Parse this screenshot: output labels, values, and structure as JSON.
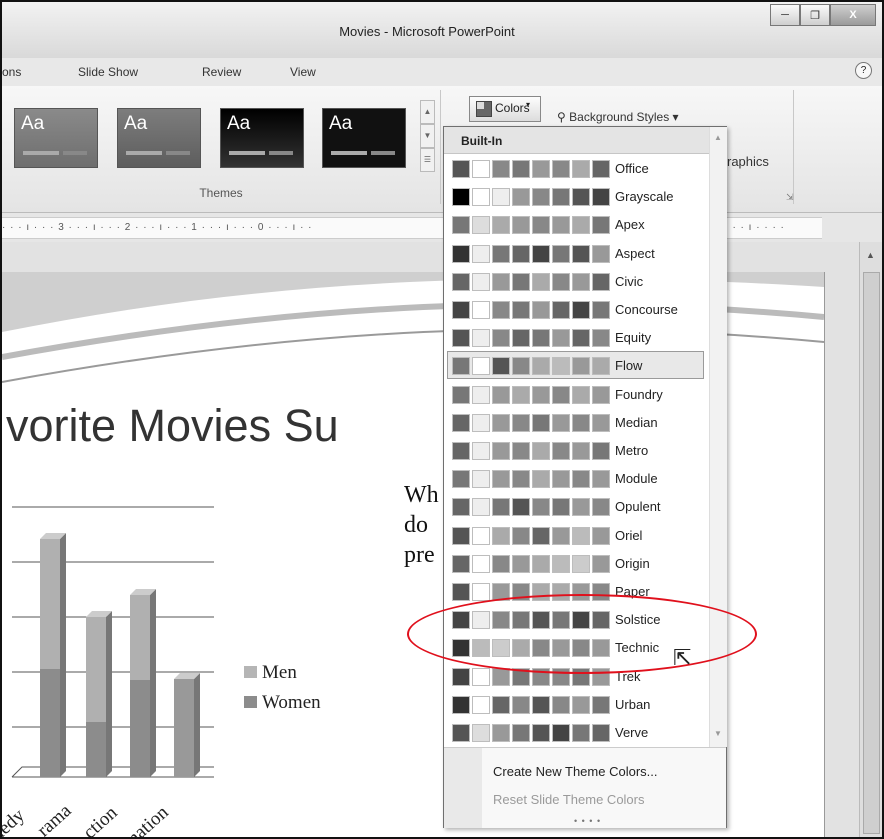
{
  "window": {
    "title": "Movies - Microsoft PowerPoint",
    "minimize": "─",
    "restore": "❐",
    "close": "X"
  },
  "ribbon_tabs": [
    "ons",
    "Slide Show",
    "Review",
    "View"
  ],
  "help": "?",
  "themes_group": {
    "label": "Themes",
    "thumbnails": [
      {
        "text": "Aa"
      },
      {
        "text": "Aa"
      },
      {
        "text": "Aa"
      },
      {
        "text": "Aa"
      }
    ]
  },
  "colors_button": {
    "label": "Colors"
  },
  "background_styles": {
    "label": "Background Styles"
  },
  "graphics_label": "raphics",
  "ruler": {
    "left": "· · · ı · · · 3 · · · ı · · · 2 · · · ı · · · 1 · · · ı · · · 0 · · · ı · ·",
    "right": "3 · · · ı · · · ·"
  },
  "slide": {
    "title": "vorite Movies Su",
    "body_lines": [
      "Wh",
      "do",
      "pre"
    ],
    "legend": [
      {
        "label": "Men",
        "color": "#b5b5b5"
      },
      {
        "label": "Women",
        "color": "#8c8c8c"
      }
    ],
    "categories": [
      "nedy",
      "rama",
      "ction",
      "nation"
    ]
  },
  "colors_dropdown": {
    "header": "Built-In",
    "selected": "Flow",
    "highlighted": "Technic",
    "themes": [
      {
        "name": "Office",
        "swatches": [
          "#555",
          "#fff",
          "#888",
          "#777",
          "#999",
          "#888",
          "#aaa",
          "#666"
        ]
      },
      {
        "name": "Grayscale",
        "swatches": [
          "#000",
          "#fff",
          "#eee",
          "#999",
          "#888",
          "#777",
          "#555",
          "#444"
        ]
      },
      {
        "name": "Apex",
        "swatches": [
          "#777",
          "#ddd",
          "#aaa",
          "#999",
          "#888",
          "#999",
          "#aaa",
          "#777"
        ]
      },
      {
        "name": "Aspect",
        "swatches": [
          "#333",
          "#eee",
          "#777",
          "#666",
          "#444",
          "#777",
          "#555",
          "#999"
        ]
      },
      {
        "name": "Civic",
        "swatches": [
          "#666",
          "#eee",
          "#999",
          "#777",
          "#aaa",
          "#888",
          "#999",
          "#666"
        ]
      },
      {
        "name": "Concourse",
        "swatches": [
          "#444",
          "#fff",
          "#888",
          "#777",
          "#999",
          "#666",
          "#444",
          "#777"
        ]
      },
      {
        "name": "Equity",
        "swatches": [
          "#555",
          "#eee",
          "#888",
          "#666",
          "#777",
          "#999",
          "#666",
          "#888"
        ]
      },
      {
        "name": "Flow",
        "swatches": [
          "#777",
          "#fff",
          "#555",
          "#888",
          "#aaa",
          "#bbb",
          "#999",
          "#aaa"
        ]
      },
      {
        "name": "Foundry",
        "swatches": [
          "#777",
          "#eee",
          "#999",
          "#aaa",
          "#999",
          "#888",
          "#aaa",
          "#999"
        ]
      },
      {
        "name": "Median",
        "swatches": [
          "#666",
          "#eee",
          "#999",
          "#888",
          "#777",
          "#999",
          "#888",
          "#999"
        ]
      },
      {
        "name": "Metro",
        "swatches": [
          "#666",
          "#eee",
          "#999",
          "#888",
          "#aaa",
          "#888",
          "#999",
          "#777"
        ]
      },
      {
        "name": "Module",
        "swatches": [
          "#777",
          "#eee",
          "#999",
          "#888",
          "#aaa",
          "#999",
          "#888",
          "#999"
        ]
      },
      {
        "name": "Opulent",
        "swatches": [
          "#666",
          "#eee",
          "#777",
          "#555",
          "#888",
          "#777",
          "#999",
          "#888"
        ]
      },
      {
        "name": "Oriel",
        "swatches": [
          "#555",
          "#fff",
          "#aaa",
          "#888",
          "#666",
          "#999",
          "#bbb",
          "#999"
        ]
      },
      {
        "name": "Origin",
        "swatches": [
          "#666",
          "#fff",
          "#888",
          "#999",
          "#aaa",
          "#bbb",
          "#ccc",
          "#999"
        ]
      },
      {
        "name": "Paper",
        "swatches": [
          "#555",
          "#fff",
          "#999",
          "#888",
          "#aaa",
          "#aaa",
          "#999",
          "#888"
        ]
      },
      {
        "name": "Solstice",
        "swatches": [
          "#444",
          "#eee",
          "#888",
          "#777",
          "#555",
          "#777",
          "#444",
          "#666"
        ]
      },
      {
        "name": "Technic",
        "swatches": [
          "#333",
          "#bbb",
          "#ccc",
          "#aaa",
          "#888",
          "#999",
          "#888",
          "#999"
        ]
      },
      {
        "name": "Trek",
        "swatches": [
          "#444",
          "#fff",
          "#999",
          "#777",
          "#888",
          "#888",
          "#777",
          "#999"
        ]
      },
      {
        "name": "Urban",
        "swatches": [
          "#333",
          "#fff",
          "#666",
          "#888",
          "#555",
          "#888",
          "#999",
          "#777"
        ]
      },
      {
        "name": "Verve",
        "swatches": [
          "#555",
          "#ddd",
          "#999",
          "#777",
          "#555",
          "#444",
          "#777",
          "#666"
        ]
      }
    ],
    "actions": [
      {
        "label": "Create New Theme Colors...",
        "enabled": true
      },
      {
        "label": "Reset Slide Theme Colors",
        "enabled": false
      }
    ]
  },
  "annotation_color": "#e0101c"
}
